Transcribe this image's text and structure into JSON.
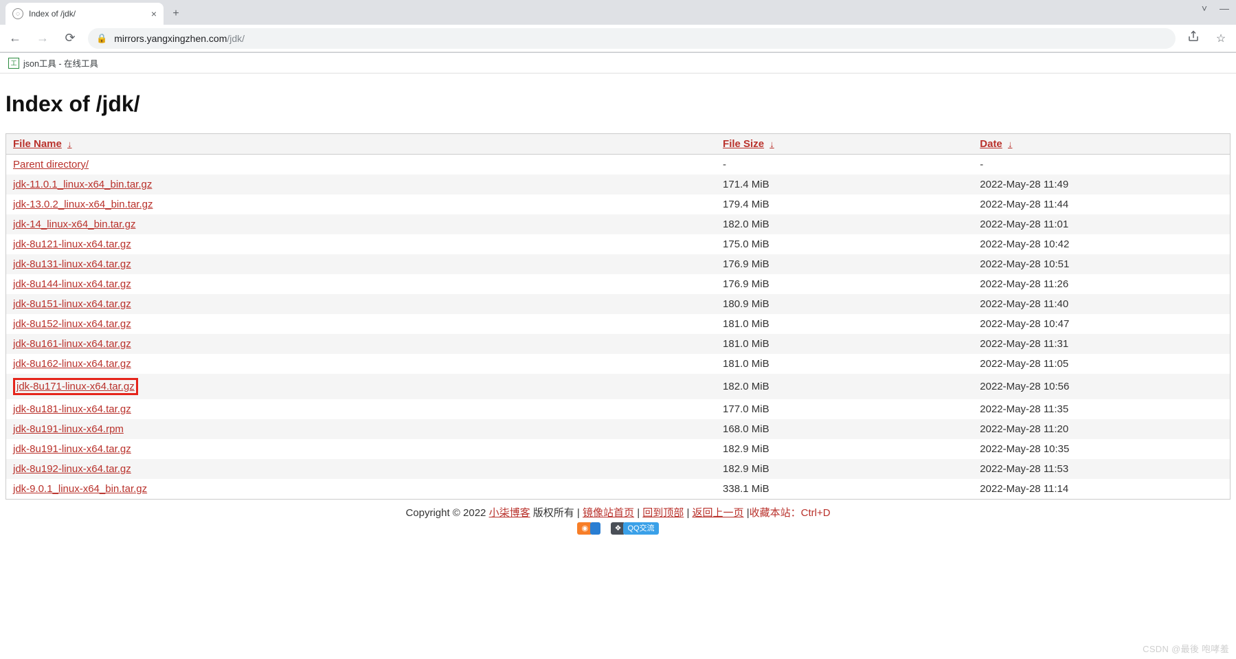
{
  "tab": {
    "title": "Index of /jdk/"
  },
  "url": {
    "host": "mirrors.yangxingzhen.com",
    "path": "/jdk/"
  },
  "bookmark": {
    "label": "json工具 - 在线工具"
  },
  "page": {
    "heading": "Index of /jdk/"
  },
  "table": {
    "headers": {
      "name": "File Name",
      "size": "File Size",
      "date": "Date",
      "arrow": "↓"
    },
    "rows": [
      {
        "name": "Parent directory/",
        "size": "-",
        "date": "-",
        "highlight": false
      },
      {
        "name": "jdk-11.0.1_linux-x64_bin.tar.gz",
        "size": "171.4 MiB",
        "date": "2022-May-28 11:49",
        "highlight": false
      },
      {
        "name": "jdk-13.0.2_linux-x64_bin.tar.gz",
        "size": "179.4 MiB",
        "date": "2022-May-28 11:44",
        "highlight": false
      },
      {
        "name": "jdk-14_linux-x64_bin.tar.gz",
        "size": "182.0 MiB",
        "date": "2022-May-28 11:01",
        "highlight": false
      },
      {
        "name": "jdk-8u121-linux-x64.tar.gz",
        "size": "175.0 MiB",
        "date": "2022-May-28 10:42",
        "highlight": false
      },
      {
        "name": "jdk-8u131-linux-x64.tar.gz",
        "size": "176.9 MiB",
        "date": "2022-May-28 10:51",
        "highlight": false
      },
      {
        "name": "jdk-8u144-linux-x64.tar.gz",
        "size": "176.9 MiB",
        "date": "2022-May-28 11:26",
        "highlight": false
      },
      {
        "name": "jdk-8u151-linux-x64.tar.gz",
        "size": "180.9 MiB",
        "date": "2022-May-28 11:40",
        "highlight": false
      },
      {
        "name": "jdk-8u152-linux-x64.tar.gz",
        "size": "181.0 MiB",
        "date": "2022-May-28 10:47",
        "highlight": false
      },
      {
        "name": "jdk-8u161-linux-x64.tar.gz",
        "size": "181.0 MiB",
        "date": "2022-May-28 11:31",
        "highlight": false
      },
      {
        "name": "jdk-8u162-linux-x64.tar.gz",
        "size": "181.0 MiB",
        "date": "2022-May-28 11:05",
        "highlight": false
      },
      {
        "name": "jdk-8u171-linux-x64.tar.gz",
        "size": "182.0 MiB",
        "date": "2022-May-28 10:56",
        "highlight": true
      },
      {
        "name": "jdk-8u181-linux-x64.tar.gz",
        "size": "177.0 MiB",
        "date": "2022-May-28 11:35",
        "highlight": false
      },
      {
        "name": "jdk-8u191-linux-x64.rpm",
        "size": "168.0 MiB",
        "date": "2022-May-28 11:20",
        "highlight": false
      },
      {
        "name": "jdk-8u191-linux-x64.tar.gz",
        "size": "182.9 MiB",
        "date": "2022-May-28 10:35",
        "highlight": false
      },
      {
        "name": "jdk-8u192-linux-x64.tar.gz",
        "size": "182.9 MiB",
        "date": "2022-May-28 11:53",
        "highlight": false
      },
      {
        "name": "jdk-9.0.1_linux-x64_bin.tar.gz",
        "size": "338.1 MiB",
        "date": "2022-May-28 11:14",
        "highlight": false
      }
    ]
  },
  "footer": {
    "copyright": "Copyright © 2022 ",
    "blog": "小柒博客",
    "rights": " 版权所有 ",
    "mirror_home": "镜像站首页",
    "back_top": "回到顶部",
    "back_prev": "返回上一页",
    "bookmark_tip": "收藏本站：Ctrl+D",
    "qq_label": "QQ交流"
  },
  "watermark": "CSDN @最後 咆哮羞"
}
